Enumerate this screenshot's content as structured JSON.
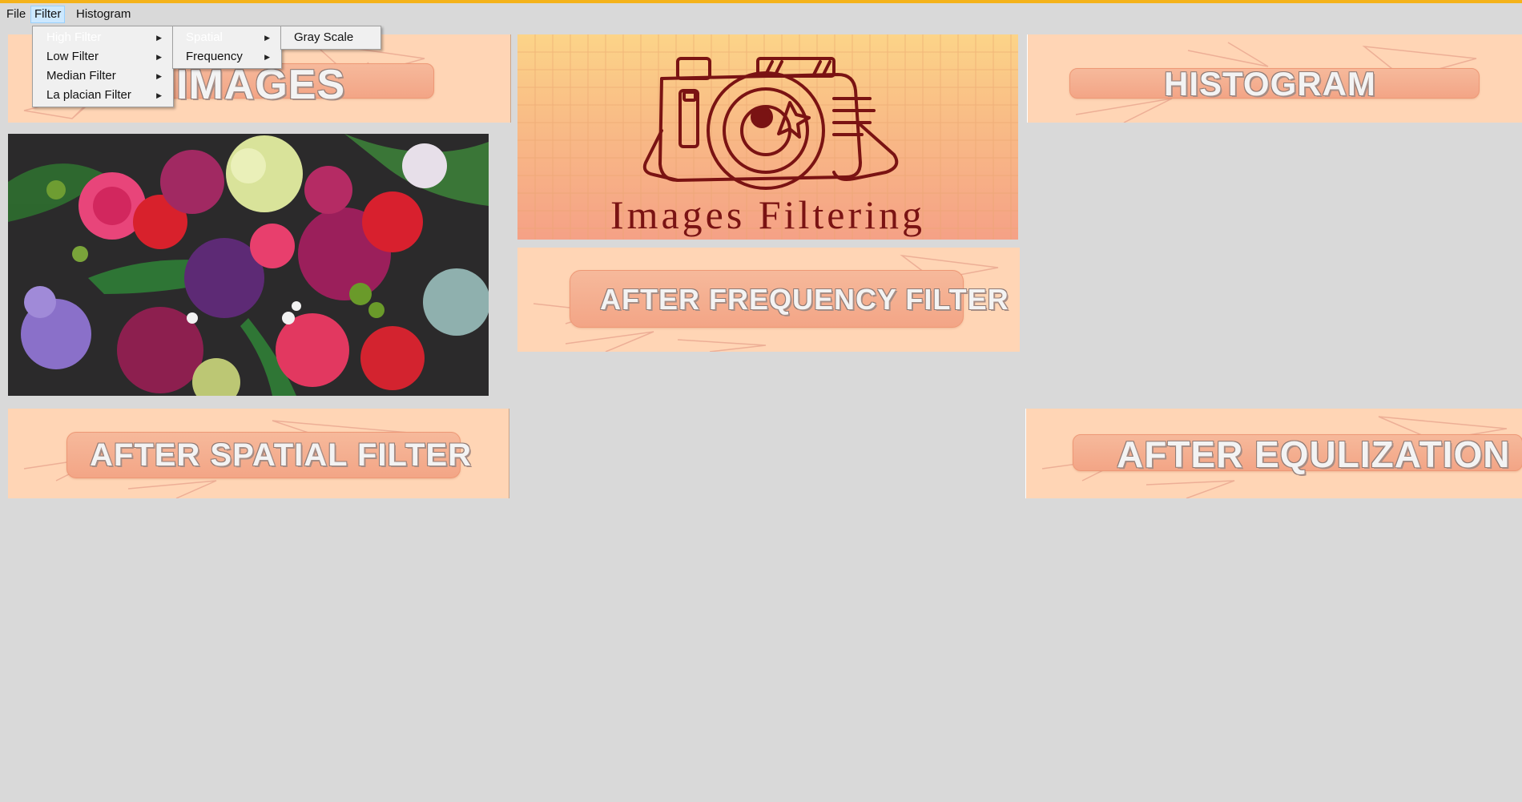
{
  "menubar": {
    "file": "File",
    "filter": "Filter",
    "histogram": "Histogram"
  },
  "filter_menu": {
    "items": [
      "High Filter",
      "Low Filter",
      "Median Filter",
      "La placian Filter"
    ]
  },
  "submenu": {
    "items": [
      "Spatial",
      "Frequency"
    ]
  },
  "subsubmenu": {
    "items": [
      "Gray Scale"
    ]
  },
  "panels": {
    "images": "IMAGES",
    "histogram": "HISTOGRAM",
    "after_frequency": "AFTER FREQUENCY FILTER",
    "after_spatial": "AFTER SPATIAL FILTER",
    "after_equalization": "AFTER EQULIZATION"
  },
  "banner": {
    "title": "Images Filtering"
  },
  "colors": {
    "accent": "#f4b21a",
    "panel_bg": "#ffd5b5",
    "pill": "#f3a586",
    "camera": "#7a1313"
  }
}
